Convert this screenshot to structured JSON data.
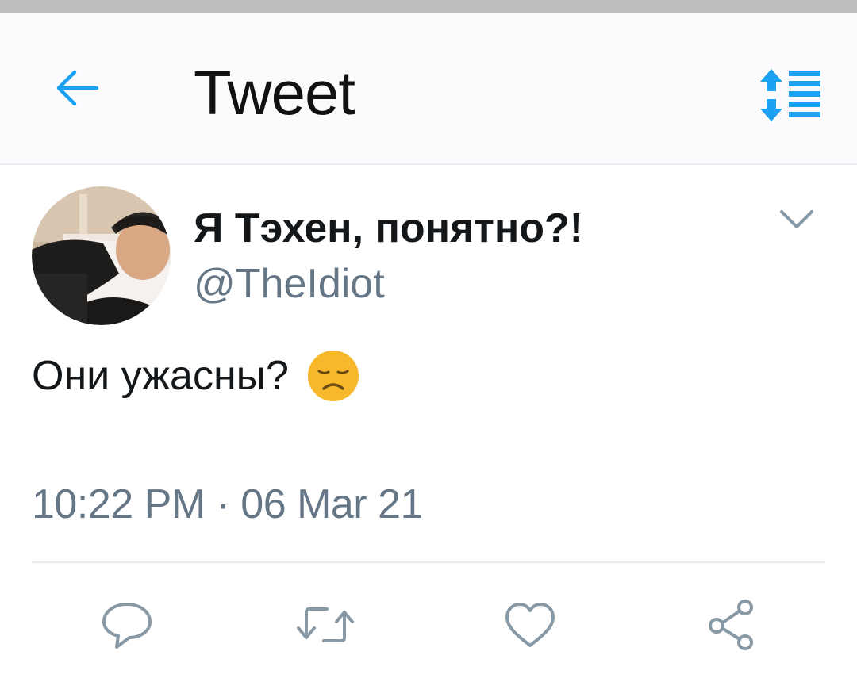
{
  "header": {
    "title": "Tweet",
    "back_icon": "arrow-left-icon",
    "sort_icon": "sort-order-icon"
  },
  "tweet": {
    "author_name": "Я Тэхен, понятно?!",
    "author_handle": "@TheIdiot",
    "text": "Они ужасны?",
    "emoji": "disappointed-face-emoji",
    "timestamp": "10:22 PM · 06 Mar 21",
    "menu_icon": "chevron-down-icon"
  },
  "actions": [
    {
      "icon": "reply-icon"
    },
    {
      "icon": "retweet-icon"
    },
    {
      "icon": "like-icon"
    },
    {
      "icon": "share-icon"
    }
  ],
  "colors": {
    "accent": "#1da1f2",
    "text": "#14171a",
    "secondary": "#657786",
    "divider": "#e6ecf0",
    "emoji": "#f7b92b"
  }
}
